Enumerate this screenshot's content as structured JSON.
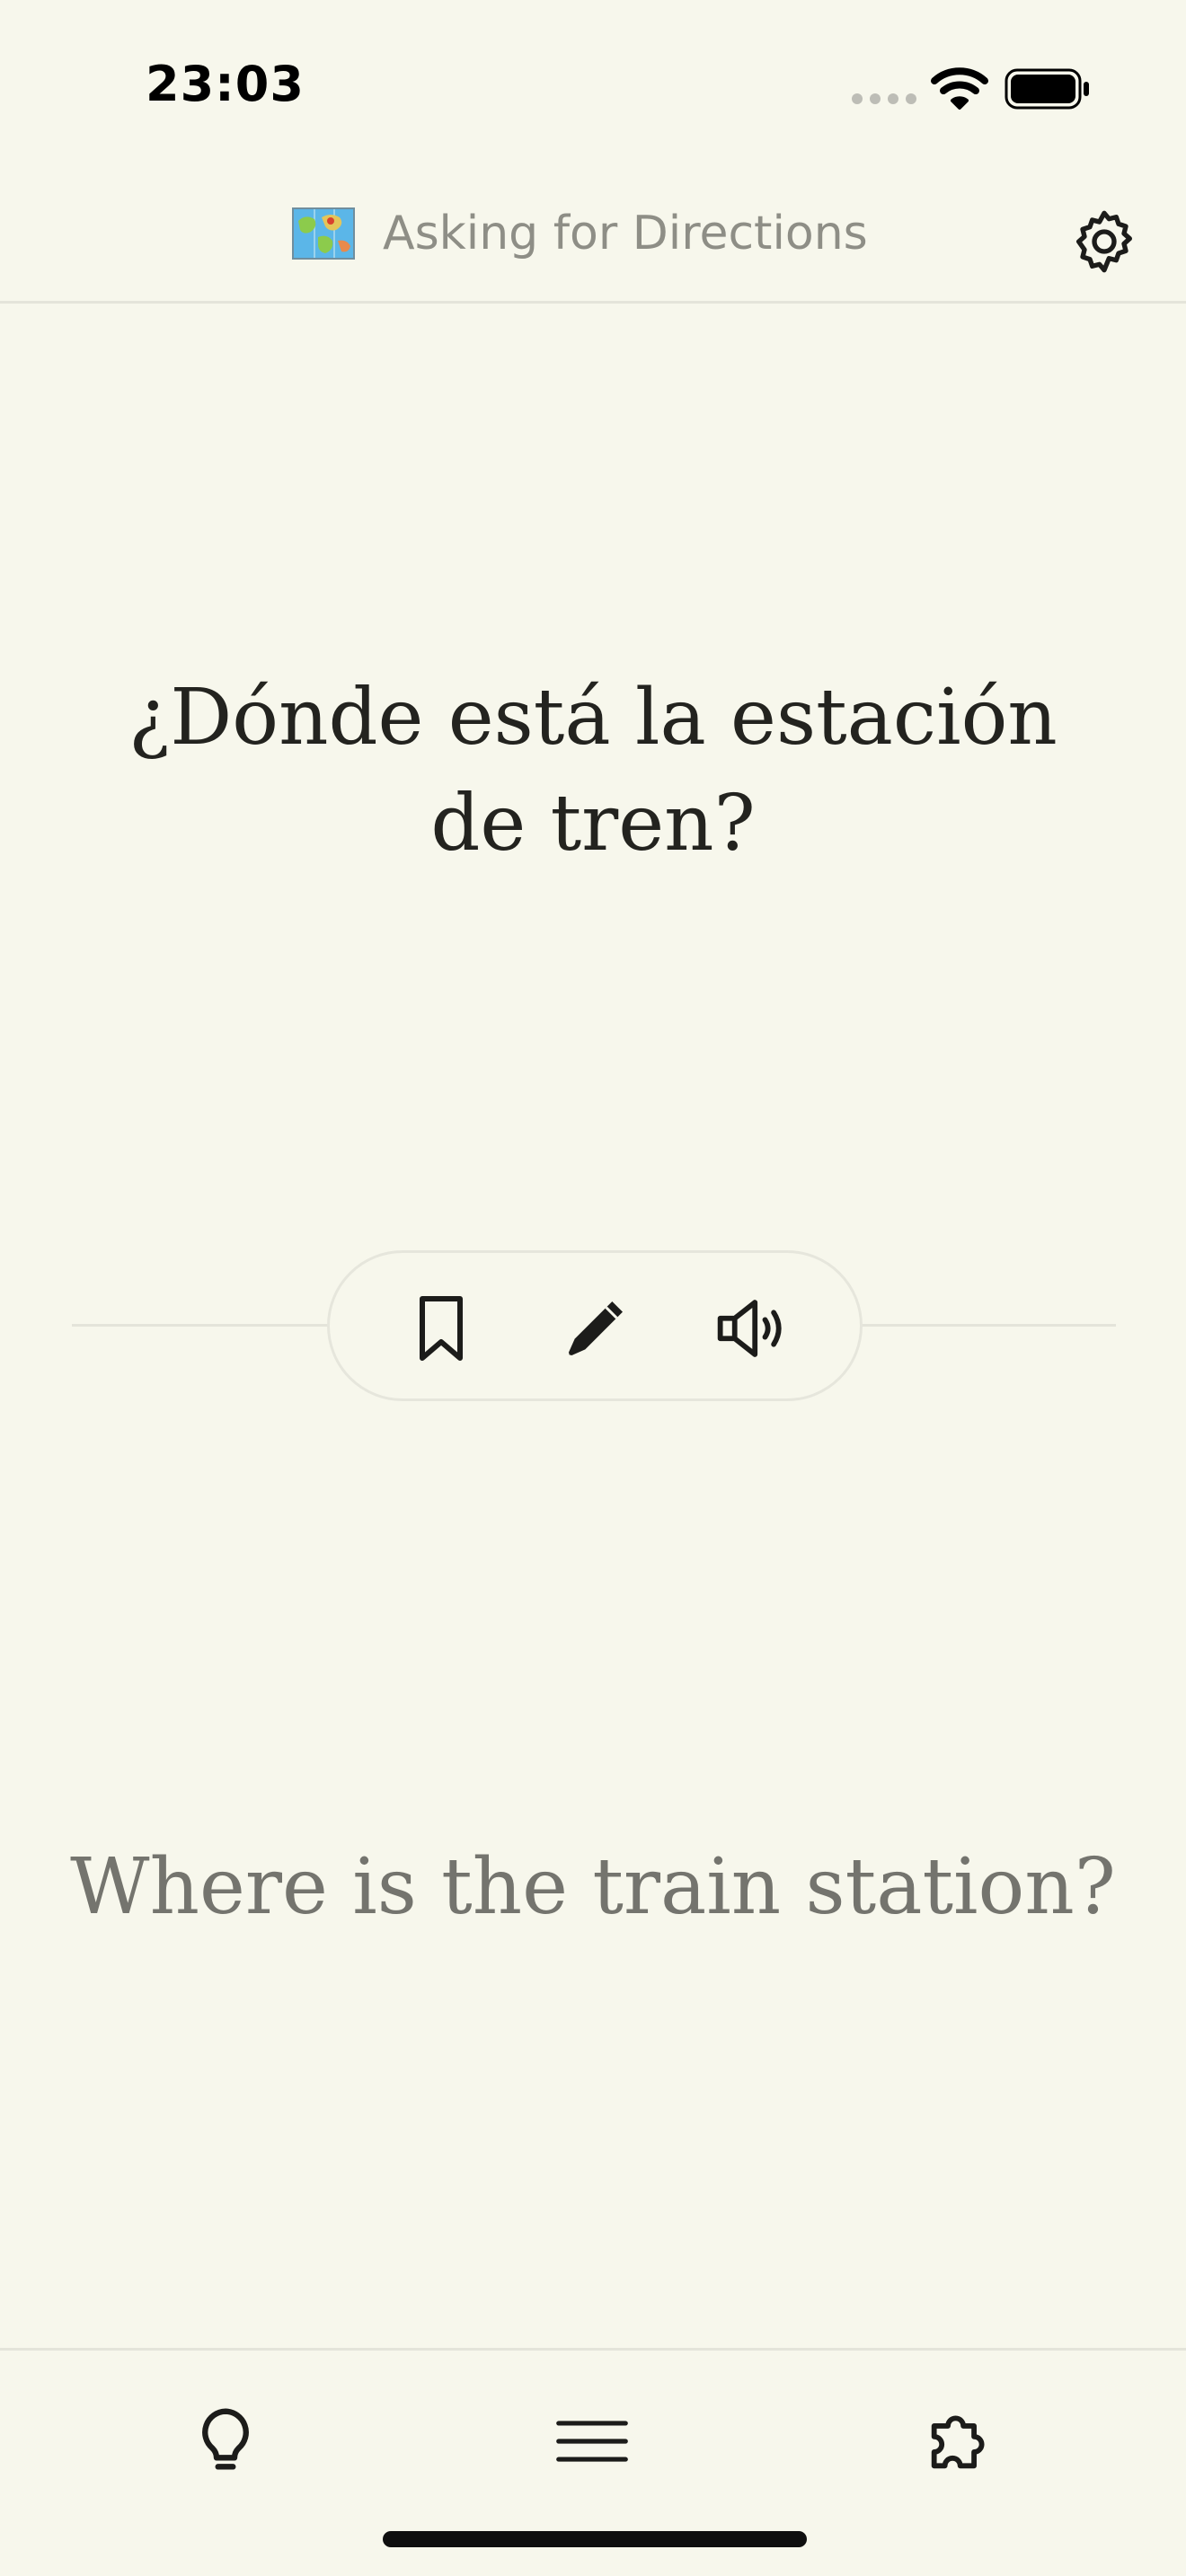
{
  "status_bar": {
    "time": "23:03",
    "icons": [
      "signal-dots-icon",
      "wifi-icon",
      "battery-icon"
    ]
  },
  "header": {
    "title": "Asking for Directions",
    "icon": "map-icon",
    "settings_icon": "gear-icon"
  },
  "card": {
    "phrase": "¿Dónde está la estación de tren?",
    "translation": "Where is the train station?",
    "actions": [
      "bookmark-icon",
      "pencil-icon",
      "speaker-icon"
    ]
  },
  "bottom_nav": {
    "items": [
      "lightbulb-icon",
      "menu-icon",
      "puzzle-icon"
    ]
  },
  "colors": {
    "background": "#F7F7EC",
    "text": "#23231F",
    "muted_text": "#74746E",
    "header_text": "#8E8E86",
    "divider": "#E4E4DA"
  }
}
